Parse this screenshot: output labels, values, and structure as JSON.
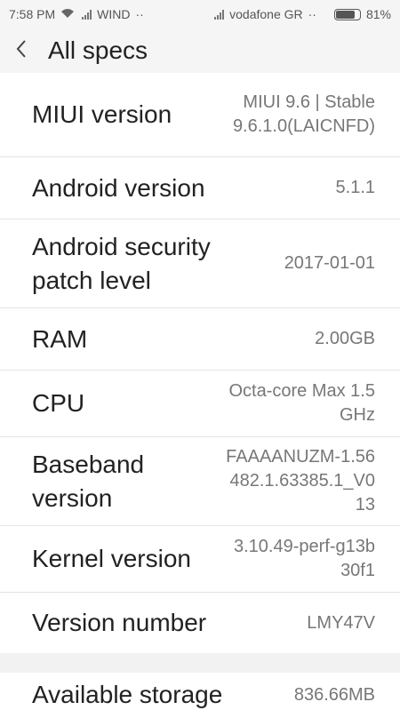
{
  "status_bar": {
    "time": "7:58 PM",
    "carrier1": "WIND",
    "carrier1_dots": "··",
    "carrier2": "vodafone GR",
    "carrier2_dots": "··",
    "battery_percent_label": "81%",
    "battery_level": 0.81
  },
  "header": {
    "title": "All specs"
  },
  "specs": [
    {
      "label": "MIUI version",
      "value": "MIUI 9.6 | Stable 9.6.1.0(LAICNFD)"
    },
    {
      "label": "Android version",
      "value": "5.1.1"
    },
    {
      "label": "Android security patch level",
      "value": "2017-01-01"
    },
    {
      "label": "RAM",
      "value": "2.00GB"
    },
    {
      "label": "CPU",
      "value": "Octa-core Max 1.5GHz"
    },
    {
      "label": "Baseband version",
      "value": "FAAAANUZM-1.56482.1.63385.1_V013"
    },
    {
      "label": "Kernel version",
      "value": "3.10.49-perf-g13b30f1"
    },
    {
      "label": "Version number",
      "value": "LMY47V"
    }
  ],
  "storage": {
    "label": "Available storage",
    "value": "836.66MB"
  }
}
